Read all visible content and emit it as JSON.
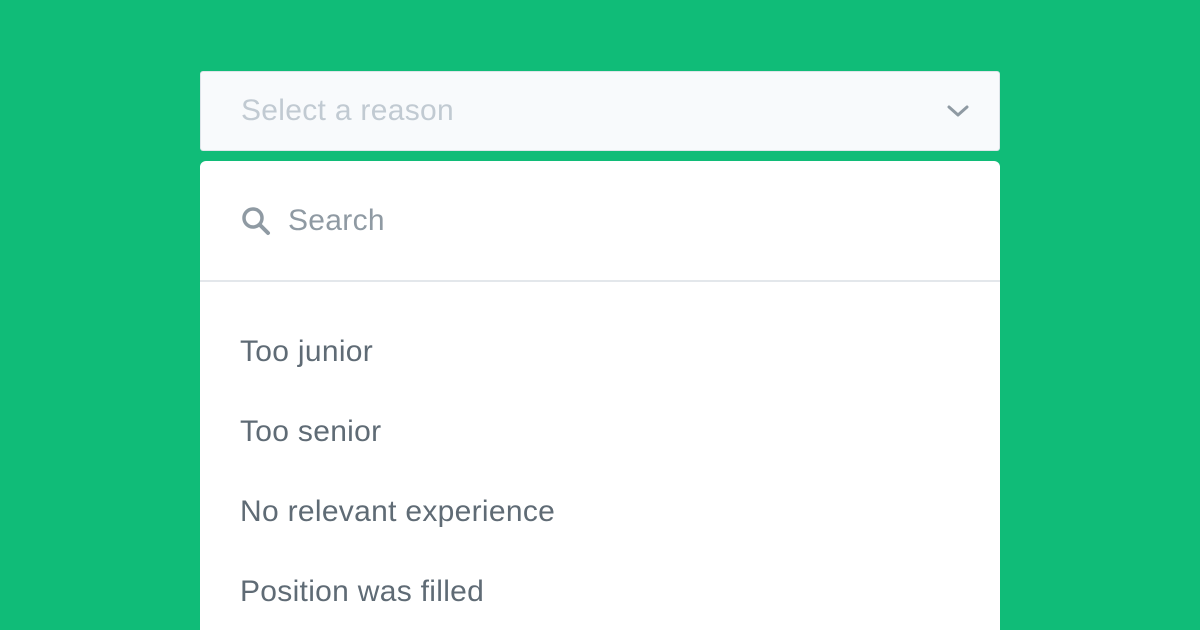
{
  "select": {
    "placeholder": "Select a reason",
    "icon": "chevron-down-icon"
  },
  "dropdown": {
    "search": {
      "placeholder": "Search",
      "value": "",
      "icon": "search-icon"
    },
    "options": [
      {
        "label": "Too junior"
      },
      {
        "label": "Too senior"
      },
      {
        "label": "No relevant experience"
      },
      {
        "label": "Position was filled"
      }
    ]
  },
  "colors": {
    "background": "#10bc78",
    "trigger_bg": "#f8fafc",
    "placeholder_text": "#c1cad2",
    "option_text": "#5f6b75",
    "icon": "#8f9aa3",
    "divider": "#e3e7eb"
  }
}
